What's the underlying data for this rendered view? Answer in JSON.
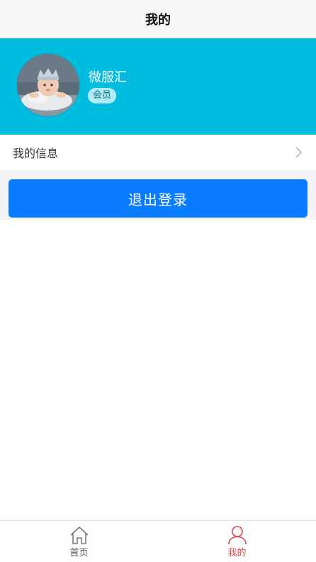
{
  "navbar": {
    "title": "我的"
  },
  "profile": {
    "username": "微服汇",
    "badge": "会员",
    "background_color": "#00bde0"
  },
  "menu": {
    "items": [
      {
        "label": "我的信息",
        "icon": "chevron-right-icon"
      }
    ]
  },
  "logout": {
    "label": "退出登录",
    "color": "#0a7cff"
  },
  "tabbar": {
    "tabs": [
      {
        "label": "首页",
        "icon": "home-icon",
        "active": false
      },
      {
        "label": "我的",
        "icon": "user-icon",
        "active": true,
        "active_color": "#e0474c"
      }
    ]
  }
}
